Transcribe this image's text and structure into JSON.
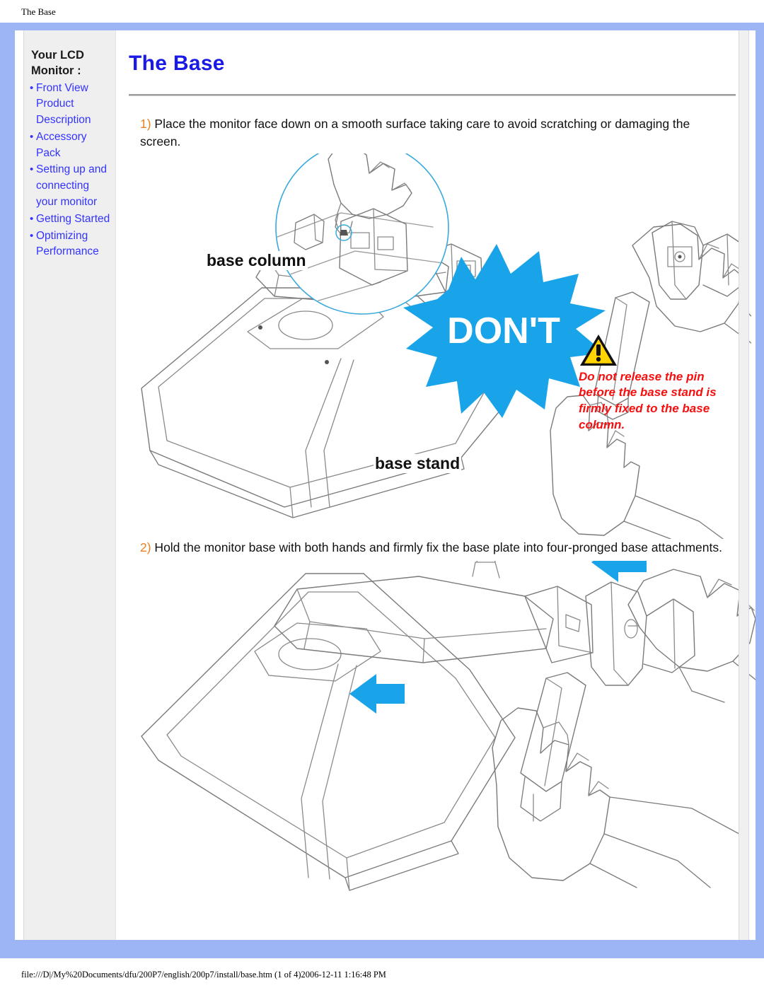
{
  "print": {
    "header_title": "The Base",
    "footer_path": "file:///D|/My%20Documents/dfu/200P7/english/200p7/install/base.htm (1 of 4)2006-12-11 1:16:48 PM"
  },
  "sidebar": {
    "heading": "Your LCD Monitor :",
    "items": [
      {
        "label": "Front View Product Description"
      },
      {
        "label": "Accessory Pack"
      },
      {
        "label": "Setting up and connecting your monitor"
      },
      {
        "label": "Getting Started"
      },
      {
        "label": "Optimizing Performance"
      }
    ]
  },
  "main": {
    "title": "The Base",
    "step1": {
      "number": "1)",
      "text": " Place the monitor face down on a smooth surface taking care to avoid scratching or damaging the screen."
    },
    "step2": {
      "number": "2)",
      "text": " Hold the monitor base with both hands and firmly fix the base plate into four-pronged base attachments."
    }
  },
  "figure1": {
    "label_base_column": "base column",
    "label_base_stand": "base stand",
    "burst_label": "DON'T"
  },
  "warning": {
    "icon": "warning-triangle-icon",
    "text": "Do not release the pin before the base stand is firmly fixed to the base column."
  },
  "colors": {
    "title_blue": "#1a1ae6",
    "link_blue": "#3333ff",
    "step_orange": "#ec7f22",
    "warning_red": "#f50f0f",
    "cyan_accent": "#19a3e8",
    "frame_periwinkle": "#9db4f5",
    "sidebar_grey": "#efefef",
    "warn_yellow": "#ffd400"
  }
}
